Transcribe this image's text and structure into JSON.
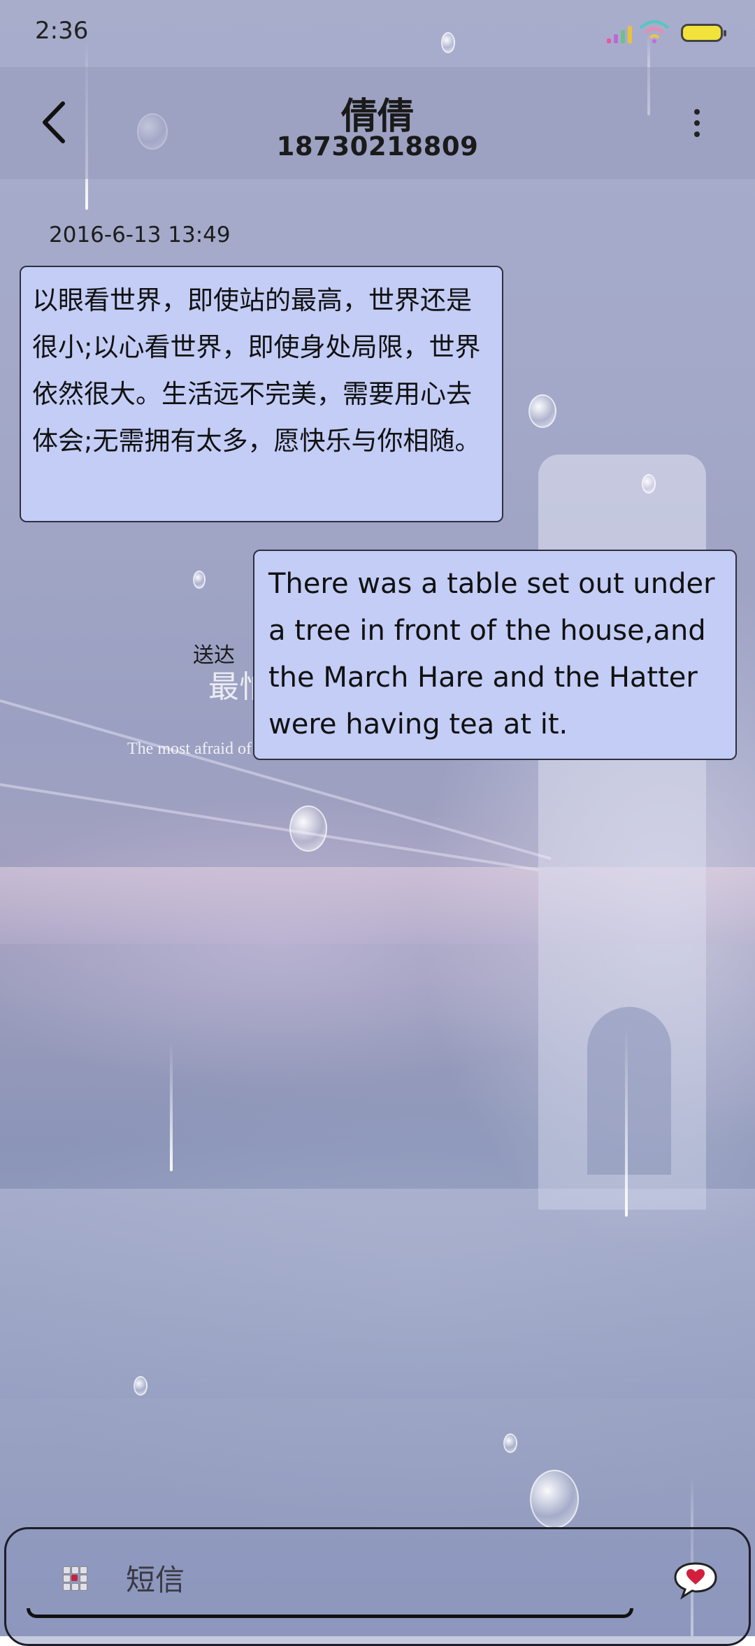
{
  "status_bar": {
    "time": "2:36",
    "icons": [
      "signal-icon",
      "wifi-icon",
      "battery-icon"
    ],
    "battery_color": "#f2e33c"
  },
  "header": {
    "contact_name": "倩倩",
    "phone_number": "18730218809",
    "back_icon": "back-chevron-icon",
    "more_icon": "more-vertical-icon"
  },
  "conversation": {
    "timestamp": "2016-6-13 13:49",
    "messages": [
      {
        "direction": "incoming",
        "text": "以眼看世界，即使站的最高，世界还是很小;以心看世界，即使身处局限，世界依然很大。生活远不完美，需要用心去体会;无需拥有太多，愿快乐与你相随。"
      },
      {
        "direction": "outgoing",
        "text": "There was a table set out under a tree in front of the house,and the March Hare and the Hatter were having tea at it."
      }
    ],
    "delivery_status": "送达"
  },
  "wallpaper": {
    "text_cn": "最怕",
    "text_en": "The most afraid of the rain more and more heavy, you go farther and farther"
  },
  "input_bar": {
    "placeholder": "短信",
    "apps_icon": "apps-grid-icon",
    "send_icon": "heart-bubble-icon"
  },
  "colors": {
    "bubble": "#c3cdf6",
    "bubble_border": "#2f2f3f",
    "heart": "#d21f3c"
  }
}
